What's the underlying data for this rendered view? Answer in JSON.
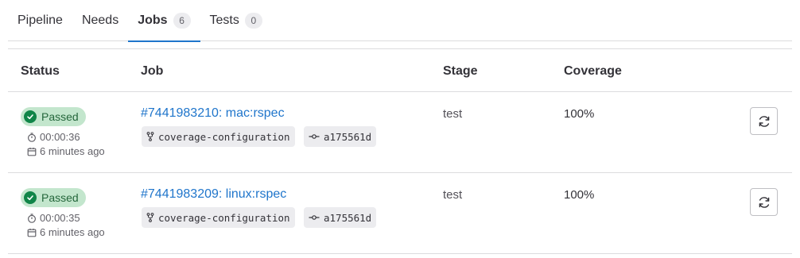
{
  "tabs": [
    {
      "label": "Pipeline"
    },
    {
      "label": "Needs"
    },
    {
      "label": "Jobs",
      "count": "6"
    },
    {
      "label": "Tests",
      "count": "0"
    }
  ],
  "table": {
    "headers": {
      "status": "Status",
      "job": "Job",
      "stage": "Stage",
      "coverage": "Coverage"
    },
    "rows": [
      {
        "status": "Passed",
        "duration": "00:00:36",
        "finished": "6 minutes ago",
        "job": "#7441983210: mac:rspec",
        "branch": "coverage-configuration",
        "commit": "a175561d",
        "stage": "test",
        "coverage": "100%"
      },
      {
        "status": "Passed",
        "duration": "00:00:35",
        "finished": "6 minutes ago",
        "job": "#7441983209: linux:rspec",
        "branch": "coverage-configuration",
        "commit": "a175561d",
        "stage": "test",
        "coverage": "100%"
      }
    ]
  },
  "colors": {
    "accent": "#1f75cb",
    "success": "#108548",
    "success_bg": "#c3e6cd"
  },
  "icons": [
    "check-circle-icon",
    "timer-icon",
    "calendar-icon",
    "branch-icon",
    "commit-icon",
    "retry-icon"
  ]
}
